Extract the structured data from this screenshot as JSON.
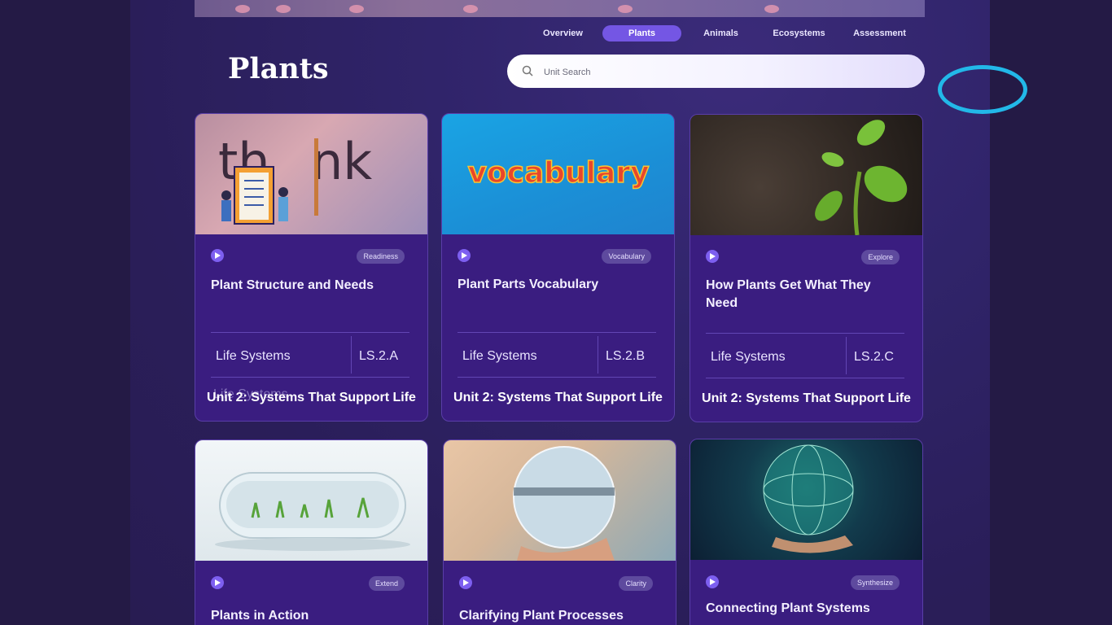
{
  "nav": {
    "tabs": [
      {
        "label": "Overview",
        "active": false
      },
      {
        "label": "Plants",
        "active": true
      },
      {
        "label": "Animals",
        "active": false
      },
      {
        "label": "Ecosystems",
        "active": false
      },
      {
        "label": "Assessment",
        "active": false
      }
    ]
  },
  "page": {
    "title": "Plants"
  },
  "search": {
    "placeholder": "Unit Search",
    "icon": "search-icon"
  },
  "colors": {
    "accent": "#7456e4",
    "card": "#3a1d80",
    "arc": "#22b8e8"
  },
  "cards": [
    {
      "badge": "Readiness",
      "title": "Plant Structure and Needs",
      "topic": "Life Systems",
      "code": "LS.2.A",
      "unit": "Unit 2: Systems That Support Life",
      "ghost": "Life Systems",
      "image": "think-illustration"
    },
    {
      "badge": "Vocabulary",
      "title": "Plant Parts Vocabulary",
      "topic": "Life Systems",
      "code": "LS.2.B",
      "unit": "Unit 2: Systems That Support Life",
      "image": "vocabulary-letters",
      "image_text": "vocabulary"
    },
    {
      "badge": "Explore",
      "title": "How Plants Get What They Need",
      "topic": "Life Systems",
      "code": "LS.2.C",
      "unit": "Unit 2: Systems That Support Life",
      "image": "seedling-photo"
    },
    {
      "badge": "Extend",
      "title": "Plants in Action",
      "image": "plant-pod-photo"
    },
    {
      "badge": "Clarity",
      "title": "Clarifying Plant Processes",
      "image": "crystal-ball-photo"
    },
    {
      "badge": "Synthesize",
      "title": "Connecting Plant Systems",
      "image": "network-globe-photo"
    }
  ]
}
